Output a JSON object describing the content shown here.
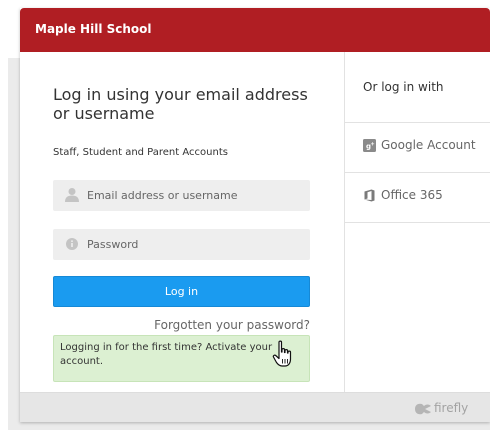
{
  "header": {
    "school_name": "Maple Hill School",
    "color": "#b01e23"
  },
  "login": {
    "title": "Log in using your email address or username",
    "accounts_label": "Staff, Student and Parent Accounts",
    "email_placeholder": "Email address or username",
    "password_placeholder": "Password",
    "email_icon": "user-icon",
    "password_icon": "info-circle-icon",
    "button_label": "Log in",
    "button_color": "#1a9bf0",
    "forgot_link": "Forgotten your password?",
    "activate_text": "Logging in for the first time? Activate your account.",
    "activate_bg": "#dcf0d2"
  },
  "alt_login": {
    "heading": "Or log in with",
    "providers": [
      {
        "label": "Google Account",
        "icon": "google-plus-icon"
      },
      {
        "label": "Office 365",
        "icon": "office-icon"
      }
    ]
  },
  "footer": {
    "brand": "firefly",
    "brand_icon": "firefly-icon"
  },
  "cursor": {
    "icon": "hand-pointer-icon"
  }
}
